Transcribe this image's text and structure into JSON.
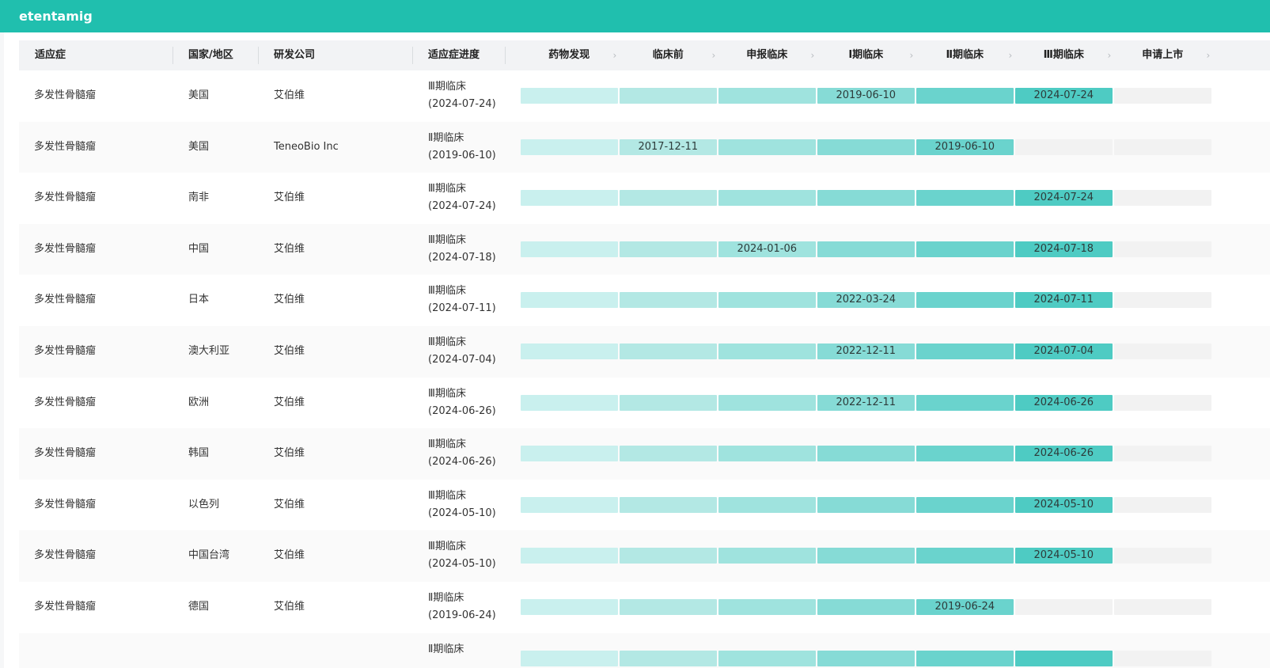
{
  "app": {
    "title": "etentamig"
  },
  "table": {
    "columns": {
      "indication": "适应症",
      "region": "国家/地区",
      "company": "研发公司",
      "progress": "适应症进度"
    },
    "stages": [
      "药物发现",
      "临床前",
      "申报临床",
      "Ⅰ期临床",
      "Ⅱ期临床",
      "Ⅲ期临床",
      "申请上市"
    ],
    "stage_colors": [
      "#c9f0ee",
      "#b3e8e4",
      "#9fe3de",
      "#86dbd6",
      "#6ad3cd",
      "#4ecbc3",
      "#f2f2f2"
    ],
    "empty_color": "#f2f2f2",
    "rows": [
      {
        "indication": "多发性骨髓瘤",
        "region": "美国",
        "company": "艾伯维",
        "status": "Ⅲ期临床",
        "status_date": "(2024-07-24)",
        "reached": 6,
        "labels": [
          "",
          "",
          "",
          "2019-06-10",
          "",
          "2024-07-24",
          ""
        ]
      },
      {
        "indication": "多发性骨髓瘤",
        "region": "美国",
        "company": "TeneoBio Inc",
        "status": "Ⅱ期临床",
        "status_date": "(2019-06-10)",
        "reached": 5,
        "labels": [
          "",
          "2017-12-11",
          "",
          "",
          "2019-06-10",
          "",
          ""
        ]
      },
      {
        "indication": "多发性骨髓瘤",
        "region": "南非",
        "company": "艾伯维",
        "status": "Ⅲ期临床",
        "status_date": "(2024-07-24)",
        "reached": 6,
        "labels": [
          "",
          "",
          "",
          "",
          "",
          "2024-07-24",
          ""
        ]
      },
      {
        "indication": "多发性骨髓瘤",
        "region": "中国",
        "company": "艾伯维",
        "status": "Ⅲ期临床",
        "status_date": "(2024-07-18)",
        "reached": 6,
        "labels": [
          "",
          "",
          "2024-01-06",
          "",
          "",
          "2024-07-18",
          ""
        ]
      },
      {
        "indication": "多发性骨髓瘤",
        "region": "日本",
        "company": "艾伯维",
        "status": "Ⅲ期临床",
        "status_date": "(2024-07-11)",
        "reached": 6,
        "labels": [
          "",
          "",
          "",
          "2022-03-24",
          "",
          "2024-07-11",
          ""
        ]
      },
      {
        "indication": "多发性骨髓瘤",
        "region": "澳大利亚",
        "company": "艾伯维",
        "status": "Ⅲ期临床",
        "status_date": "(2024-07-04)",
        "reached": 6,
        "labels": [
          "",
          "",
          "",
          "2022-12-11",
          "",
          "2024-07-04",
          ""
        ]
      },
      {
        "indication": "多发性骨髓瘤",
        "region": "欧洲",
        "company": "艾伯维",
        "status": "Ⅲ期临床",
        "status_date": "(2024-06-26)",
        "reached": 6,
        "labels": [
          "",
          "",
          "",
          "2022-12-11",
          "",
          "2024-06-26",
          ""
        ]
      },
      {
        "indication": "多发性骨髓瘤",
        "region": "韩国",
        "company": "艾伯维",
        "status": "Ⅲ期临床",
        "status_date": "(2024-06-26)",
        "reached": 6,
        "labels": [
          "",
          "",
          "",
          "",
          "",
          "2024-06-26",
          ""
        ]
      },
      {
        "indication": "多发性骨髓瘤",
        "region": "以色列",
        "company": "艾伯维",
        "status": "Ⅲ期临床",
        "status_date": "(2024-05-10)",
        "reached": 6,
        "labels": [
          "",
          "",
          "",
          "",
          "",
          "2024-05-10",
          ""
        ]
      },
      {
        "indication": "多发性骨髓瘤",
        "region": "中国台湾",
        "company": "艾伯维",
        "status": "Ⅲ期临床",
        "status_date": "(2024-05-10)",
        "reached": 6,
        "labels": [
          "",
          "",
          "",
          "",
          "",
          "2024-05-10",
          ""
        ]
      },
      {
        "indication": "多发性骨髓瘤",
        "region": "德国",
        "company": "艾伯维",
        "status": "Ⅱ期临床",
        "status_date": "(2019-06-24)",
        "reached": 5,
        "labels": [
          "",
          "",
          "",
          "",
          "2019-06-24",
          "",
          ""
        ]
      },
      {
        "indication": "",
        "region": "",
        "company": "",
        "status": "Ⅱ期临床",
        "status_date": "",
        "reached": 6,
        "labels": [
          "",
          "",
          "",
          "",
          "",
          "",
          ""
        ]
      }
    ]
  }
}
